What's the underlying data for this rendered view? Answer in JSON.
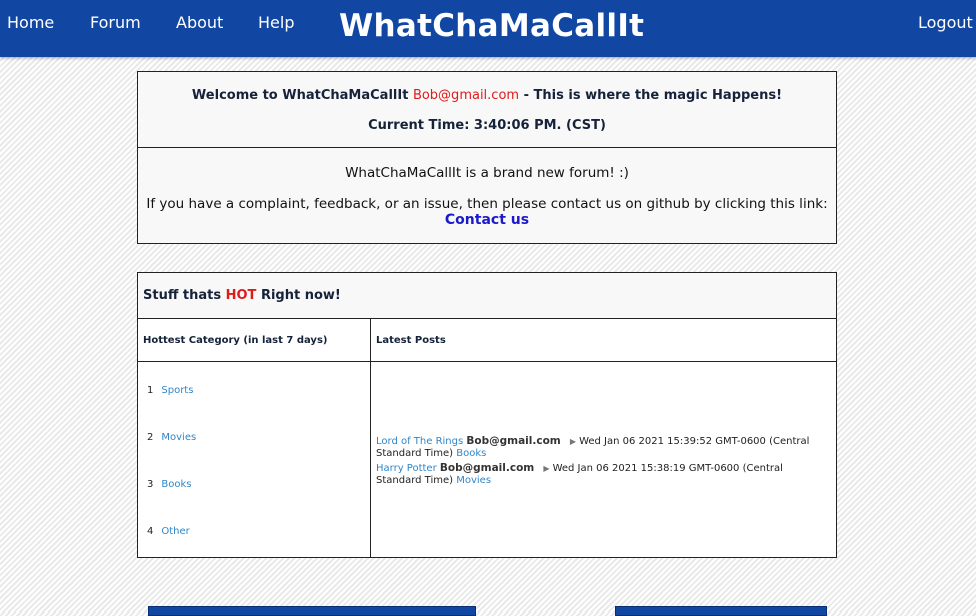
{
  "nav": {
    "home": "Home",
    "forum": "Forum",
    "about": "About",
    "help": "Help",
    "title": "WhatChaMaCallIt",
    "logout": "Logout"
  },
  "welcome": {
    "prefix": "Welcome to WhatChaMaCallIt ",
    "email": "Bob@gmail.com",
    "suffix": " - This is where the magic Happens!",
    "time": "Current Time: 3:40:06 PM. (CST)",
    "intro": "WhatChaMaCallIt is a brand new forum! :)",
    "feedback": "If you have a complaint, feedback, or an issue, then please contact us on github by clicking this link:",
    "contact_link": "Contact us"
  },
  "hot": {
    "title_prefix": "Stuff thats ",
    "title_hot": "HOT",
    "title_suffix": " Right now!",
    "col_category": "Hottest Category (in last 7 days)",
    "col_posts": "Latest Posts",
    "categories": [
      {
        "rank": "1",
        "name": "Sports"
      },
      {
        "rank": "2",
        "name": "Movies"
      },
      {
        "rank": "3",
        "name": "Books"
      },
      {
        "rank": "4",
        "name": "Other"
      }
    ],
    "posts": [
      {
        "title": "Lord of The Rings",
        "author": "Bob@gmail.com",
        "date": "Wed Jan 06 2021 15:39:52 GMT-0600 (Central Standard Time)",
        "category": "Books"
      },
      {
        "title": "Harry Potter",
        "author": "Bob@gmail.com",
        "date": "Wed Jan 06 2021 15:38:19 GMT-0600 (Central Standard Time)",
        "category": "Movies"
      }
    ]
  },
  "colors": {
    "nav_bg": "#1147a3",
    "accent_red": "#e01a1a",
    "link_blue": "#2f86c9",
    "contact_blue": "#1a1acb"
  },
  "icons": {
    "post_separator": "triangle-right-icon"
  }
}
